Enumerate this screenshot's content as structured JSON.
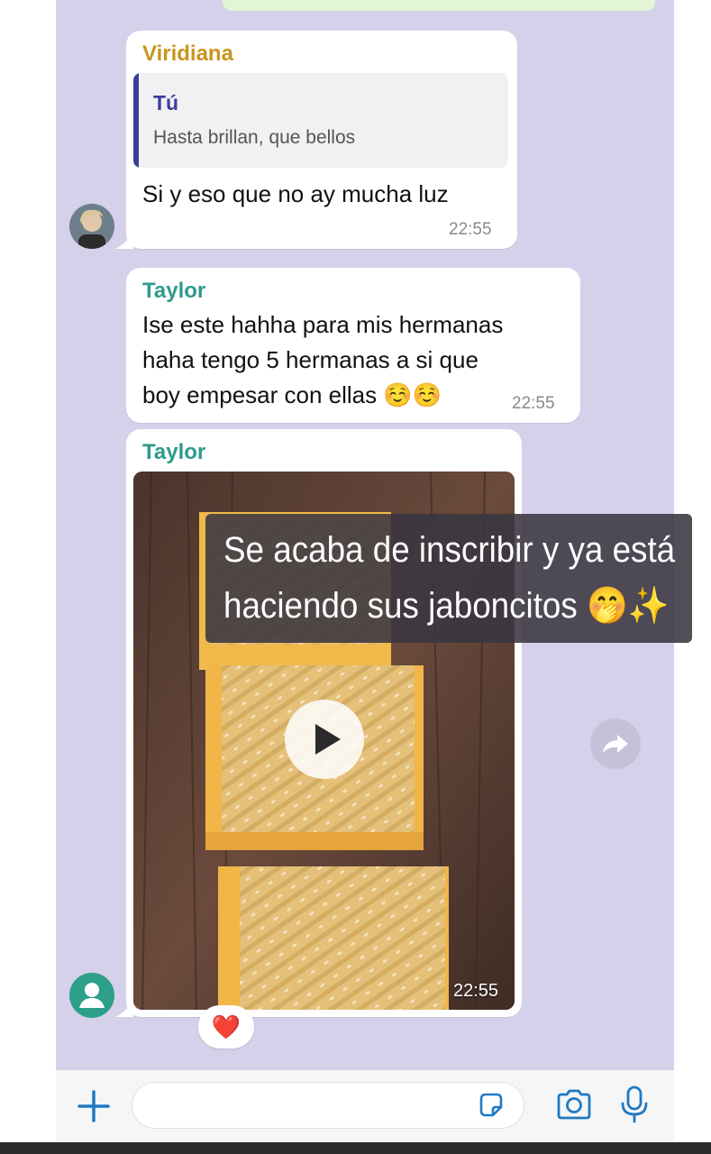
{
  "messages": [
    {
      "sender": "Viridiana",
      "sender_color": "#c8961e",
      "quote": {
        "name": "Tú",
        "text": "Hasta brillan, que bellos"
      },
      "text": "Si y eso que no ay mucha luz",
      "time": "22:55"
    },
    {
      "sender": "Taylor",
      "sender_color": "#2e9a8c",
      "lines": [
        "Ise este hahha para mis hermanas",
        "haha tengo 5 hermanas a si que",
        "boy empesar con ellas ☺️☺️"
      ],
      "time": "22:55"
    },
    {
      "sender": "Taylor",
      "sender_color": "#2e9a8c",
      "media": "video",
      "time": "22:55",
      "reaction": "❤️"
    }
  ],
  "overlay": {
    "line1": "Se acaba de inscribir y ya está",
    "line2": "haciendo sus jaboncitos 🤭✨"
  },
  "icons": {
    "add": "plus-icon",
    "sticker": "sticker-icon",
    "camera": "camera-icon",
    "mic": "microphone-icon",
    "play": "play-icon",
    "forward": "forward-icon"
  },
  "colors": {
    "chat_bg": "#d6d1ea",
    "accent": "#1f79c3"
  }
}
